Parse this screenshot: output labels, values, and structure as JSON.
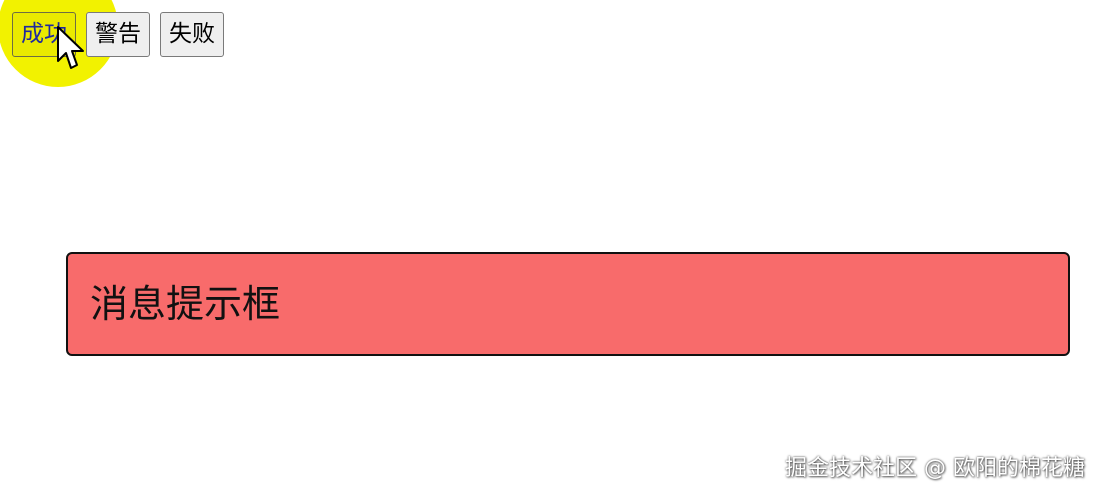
{
  "buttons": [
    {
      "label": "成功"
    },
    {
      "label": "警告"
    },
    {
      "label": "失败"
    }
  ],
  "message": {
    "text": "消息提示框"
  },
  "watermark": "掘金技术社区 @ 欧阳的棉花糖",
  "colors": {
    "click_highlight": "#f2f200",
    "success_button_bg": "#eaea00",
    "success_button_text": "#1f2aa0",
    "button_bg": "#efefef",
    "message_bg": "#f86b6b",
    "message_border": "#111111"
  },
  "icons": {
    "cursor": "mouse-pointer-icon"
  }
}
